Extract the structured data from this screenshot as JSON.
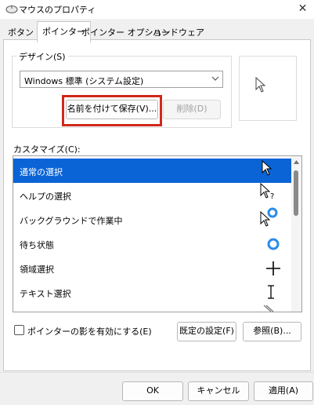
{
  "window": {
    "title": "マウスのプロパティ",
    "close_glyph": "✕"
  },
  "tabs": [
    {
      "label": "ボタン",
      "active": false
    },
    {
      "label": "ポインター",
      "active": true
    },
    {
      "label": "ポインター オプション",
      "active": false
    },
    {
      "label": "ハードウェア",
      "active": false
    }
  ],
  "design": {
    "label": "デザイン(S)",
    "scheme_value": "Windows 標準 (システム設定)",
    "save_as_button": "名前を付けて保存(V)...",
    "delete_button": "削除(D)"
  },
  "customize": {
    "label": "カスタマイズ(C):",
    "items": [
      {
        "label": "通常の選択",
        "cursor_icon": "arrow-cursor-icon",
        "selected": true
      },
      {
        "label": "ヘルプの選択",
        "cursor_icon": "help-cursor-icon",
        "selected": false
      },
      {
        "label": "バックグラウンドで作業中",
        "cursor_icon": "working-in-background-cursor-icon",
        "selected": false
      },
      {
        "label": "待ち状態",
        "cursor_icon": "busy-cursor-icon",
        "selected": false
      },
      {
        "label": "領域選択",
        "cursor_icon": "precision-select-cursor-icon",
        "selected": false
      },
      {
        "label": "テキスト選択",
        "cursor_icon": "text-select-cursor-icon",
        "selected": false
      }
    ]
  },
  "shadow": {
    "label": "ポインターの影を有効にする(E)",
    "checked": false
  },
  "buttons": {
    "use_default": "既定の設定(F)",
    "browse": "参照(B)...",
    "ok": "OK",
    "cancel": "キャンセル",
    "apply": "適用(A)"
  },
  "colors": {
    "selection": "#0a64d6",
    "highlight_border": "#d0281c",
    "busy_ring": "#2b8be8"
  }
}
